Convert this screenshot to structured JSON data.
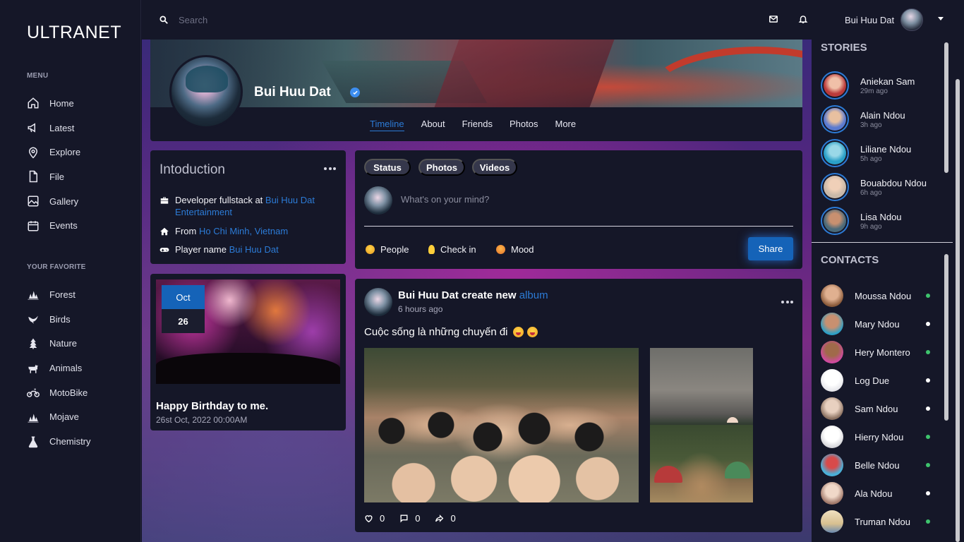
{
  "app": {
    "logo": "ULTRANET"
  },
  "sidebar": {
    "menu_heading": "MENU",
    "menu": [
      {
        "label": "Home",
        "icon": "home-icon"
      },
      {
        "label": "Latest",
        "icon": "megaphone-icon"
      },
      {
        "label": "Explore",
        "icon": "location-pin-icon"
      },
      {
        "label": "File",
        "icon": "file-icon"
      },
      {
        "label": "Gallery",
        "icon": "gallery-icon"
      },
      {
        "label": "Events",
        "icon": "calendar-icon"
      }
    ],
    "favorite_heading": "YOUR FAVORITE",
    "favorites": [
      {
        "label": "Forest",
        "icon": "forest-icon"
      },
      {
        "label": "Birds",
        "icon": "bird-icon"
      },
      {
        "label": "Nature",
        "icon": "tree-icon"
      },
      {
        "label": "Animals",
        "icon": "animal-icon"
      },
      {
        "label": "MotoBike",
        "icon": "motorbike-icon"
      },
      {
        "label": "Mojave",
        "icon": "desert-icon"
      },
      {
        "label": "Chemistry",
        "icon": "flask-icon"
      }
    ]
  },
  "topbar": {
    "search_placeholder": "Search",
    "user_name": "Bui Huu Dat"
  },
  "profile": {
    "name": "Bui Huu Dat",
    "tabs": [
      "Timeline",
      "About",
      "Friends",
      "Photos",
      "More"
    ],
    "active_tab": "Timeline"
  },
  "intro": {
    "title": "Intoduction",
    "job_prefix": "Developer fullstack at",
    "job_link": "Bui Huu Dat Entertainment",
    "from_prefix": "From",
    "from_link": "Ho Chi Minh, Vietnam",
    "player_prefix": "Player name",
    "player_link": "Bui Huu Dat"
  },
  "event": {
    "month": "Oct",
    "day": "26",
    "title": "Happy Birthday to me.",
    "time": "26st Oct, 2022 00:00AM"
  },
  "composer": {
    "pills": [
      "Status",
      "Photos",
      "Videos"
    ],
    "placeholder": "What's on your mind?",
    "options": [
      "People",
      "Check in",
      "Mood"
    ],
    "share_label": "Share"
  },
  "post": {
    "author": "Bui Huu Dat",
    "action": "create new",
    "object": "album",
    "time": "6 hours ago",
    "text": "Cuộc sống là những chuyến đi",
    "likes": "0",
    "comments": "0",
    "shares": "0"
  },
  "stories": {
    "title": "STORIES",
    "items": [
      {
        "name": "Aniekan Sam",
        "time": "29m ago",
        "color": "#b93a3a"
      },
      {
        "name": "Alain Ndou",
        "time": "3h ago",
        "color": "#5a7ad0"
      },
      {
        "name": "Liliane Ndou",
        "time": "5h ago",
        "color": "#2aa0c8"
      },
      {
        "name": "Bouabdou Ndou",
        "time": "6h ago",
        "color": "#c8b8a8"
      },
      {
        "name": "Lisa Ndou",
        "time": "9h ago",
        "color": "#4a6a7a"
      }
    ]
  },
  "contacts": {
    "title": "CONTACTS",
    "items": [
      {
        "name": "Moussa Ndou",
        "online": true,
        "color": "#c8906a"
      },
      {
        "name": "Mary Ndou",
        "online": false,
        "color": "#d05a8a"
      },
      {
        "name": "Hery Montero",
        "online": true,
        "color": "#8a4ad0"
      },
      {
        "name": "Log Due",
        "online": false,
        "color": "#e8e8ec"
      },
      {
        "name": "Sam Ndou",
        "online": false,
        "color": "#b8a090"
      },
      {
        "name": "Hierry Ndou",
        "online": true,
        "color": "#f0f0f2"
      },
      {
        "name": "Belle Ndou",
        "online": true,
        "color": "#4ab0d8"
      },
      {
        "name": "Ala Ndou",
        "online": false,
        "color": "#e0c8c0"
      },
      {
        "name": "Truman Ndou",
        "online": true,
        "color": "#d8c090"
      }
    ]
  },
  "colors": {
    "accent": "#2c7bd6",
    "panel": "#151728",
    "online": "#3ec46d",
    "offline": "#ffffff"
  }
}
